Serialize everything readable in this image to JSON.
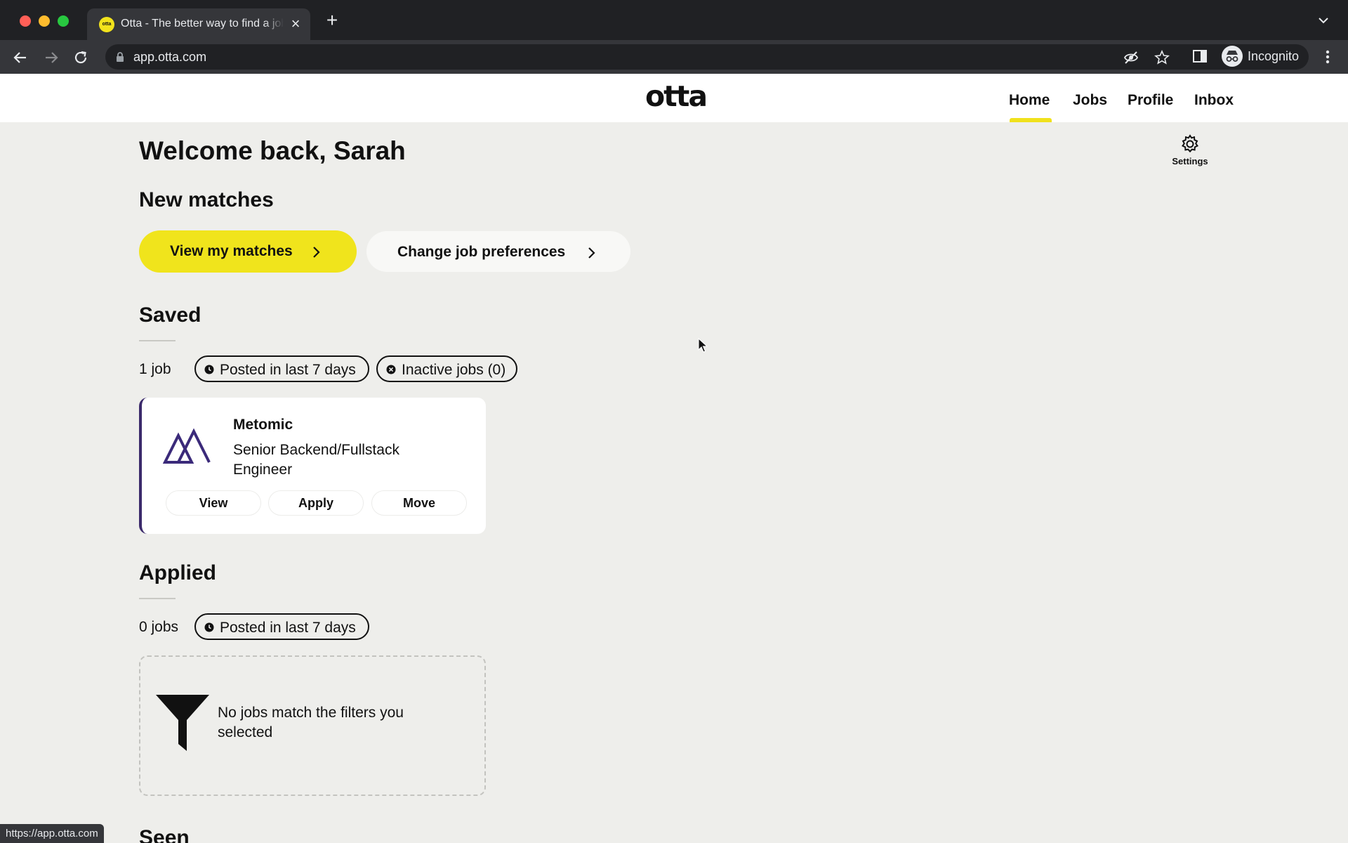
{
  "browser": {
    "tab_title": "Otta - The better way to find a job",
    "favicon_text": "otta",
    "url": "app.otta.com",
    "profile_label": "Incognito",
    "status_url": "https://app.otta.com"
  },
  "header": {
    "logo": "otta",
    "nav": [
      {
        "label": "Home",
        "active": true
      },
      {
        "label": "Jobs",
        "active": false
      },
      {
        "label": "Profile",
        "active": false
      },
      {
        "label": "Inbox",
        "active": false
      }
    ],
    "active_color": "#f0e11c"
  },
  "page": {
    "welcome": "Welcome back, Sarah",
    "settings_label": "Settings"
  },
  "new_matches": {
    "heading": "New matches",
    "view_button": "View my matches",
    "prefs_button": "Change job preferences",
    "accent_color": "#f0e41c"
  },
  "saved": {
    "heading": "Saved",
    "count": "1 job",
    "filters": [
      "Posted in last 7 days",
      "Inactive jobs (0)"
    ],
    "jobs": [
      {
        "company": "Metomic",
        "title": "Senior Backend/Fullstack Engineer",
        "logo_icon": "metomic-logo",
        "actions": [
          "View",
          "Apply",
          "Move"
        ]
      }
    ]
  },
  "applied": {
    "heading": "Applied",
    "count": "0 jobs",
    "filters": [
      "Posted in last 7 days"
    ],
    "empty_message": "No jobs match the filters you selected",
    "empty_icon": "filter-icon"
  },
  "seen": {
    "heading": "Seen"
  }
}
